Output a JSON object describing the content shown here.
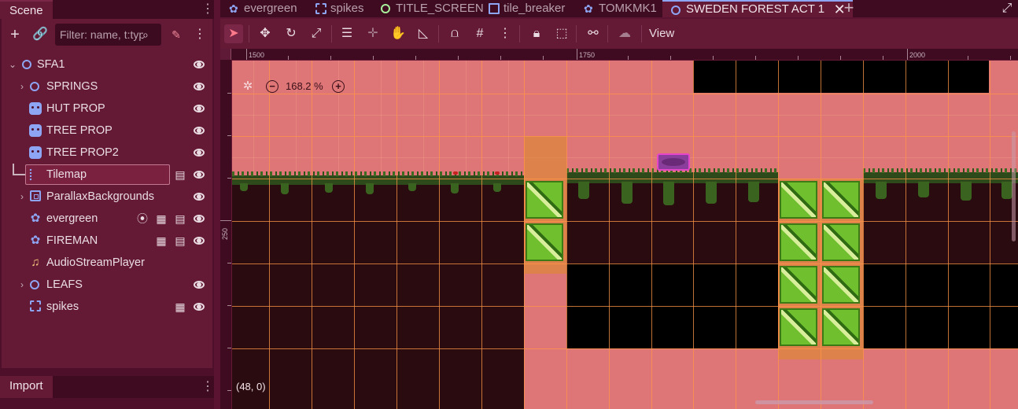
{
  "scene_dock": {
    "title": "Scene",
    "filter_placeholder": "Filter: name, t:type, g:group"
  },
  "tree": [
    {
      "label": "SFA1",
      "icon": "node2d-icon",
      "expanded": true
    },
    {
      "label": "SPRINGS",
      "icon": "node2d-icon",
      "collapsed": true
    },
    {
      "label": "HUT PROP",
      "icon": "sprite-icon"
    },
    {
      "label": "TREE PROP",
      "icon": "sprite-icon"
    },
    {
      "label": "TREE PROP2",
      "icon": "sprite-icon"
    },
    {
      "label": "Tilemap",
      "icon": "tilemap-icon",
      "selected": true
    },
    {
      "label": "ParallaxBackgrounds",
      "icon": "parallax-icon",
      "collapsed": true
    },
    {
      "label": "evergreen",
      "icon": "character-body-icon"
    },
    {
      "label": "FIREMAN",
      "icon": "character-body-icon"
    },
    {
      "label": "AudioStreamPlayer",
      "icon": "audio-icon"
    },
    {
      "label": "LEAFS",
      "icon": "node2d-icon",
      "collapsed": true
    },
    {
      "label": "spikes",
      "icon": "area-icon"
    }
  ],
  "import_dock": {
    "title": "Import"
  },
  "scene_tabs": [
    {
      "label": "evergreen",
      "icon": "character-body-icon"
    },
    {
      "label": "spikes",
      "icon": "area-icon"
    },
    {
      "label": "TITLE_SCREEN",
      "icon": "control-icon"
    },
    {
      "label": "tile_breaker",
      "icon": "bracket-icon"
    },
    {
      "label": "TOMKMK1",
      "icon": "character-body-icon"
    },
    {
      "label": "SWEDEN FOREST ACT 1",
      "icon": "node2d-icon",
      "active": true
    }
  ],
  "toolbar": {
    "view_label": "View"
  },
  "viewport": {
    "zoom_label": "168.2 %",
    "coordinate_readout": "(48, 0)",
    "ruler_top_labels": [
      "1500",
      "1750",
      "2000"
    ],
    "ruler_left_labels": [
      "250"
    ]
  },
  "colors": {
    "background": "#de7577",
    "selection_accent": "#8da5f3",
    "grid_lines": "#ff9646"
  }
}
